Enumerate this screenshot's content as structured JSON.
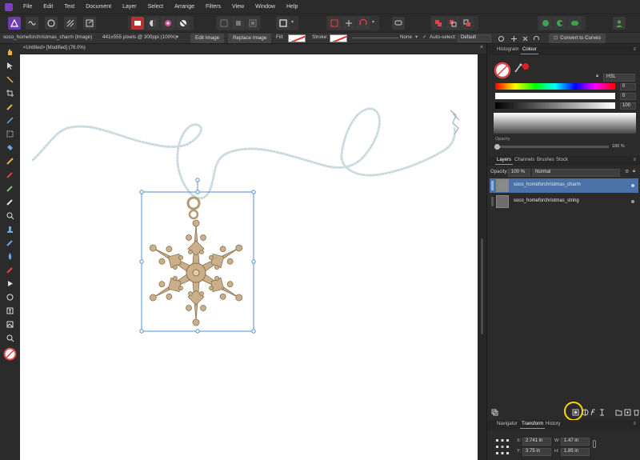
{
  "menu": {
    "items": [
      "File",
      "Edit",
      "Text",
      "Document",
      "Layer",
      "Select",
      "Arrange",
      "Filters",
      "View",
      "Window",
      "Help"
    ]
  },
  "context_toolbar": {
    "layer_name": "soco_homeforchristmas_charm (Image)",
    "image_info": "441x555 pixels @ 300ppi (100%)",
    "edit_image_label": "Edit Image",
    "replace_image_label": "Replace Image",
    "fill_label": "Fill:",
    "stroke_label": "Stroke:",
    "stroke_width_value": "None",
    "auto_select_label": "Auto-select:",
    "auto_select_value": "Default",
    "convert_to_curves_label": "Convert to Curves"
  },
  "document": {
    "tab_title": "<Untitled> [Modified] (76.0%)"
  },
  "colour_panel": {
    "tabs": [
      "Histogram",
      "Colour"
    ],
    "active_tab": "Colour",
    "model": "HSL",
    "sliders": [
      {
        "label": "H",
        "value": "0"
      },
      {
        "label": "S",
        "value": "0"
      },
      {
        "label": "L",
        "value": "100"
      }
    ],
    "opacity_label": "Opacity",
    "opacity_value": "100 %"
  },
  "layers_panel": {
    "tabs": [
      "Layers",
      "Channels",
      "Brushes",
      "Stock"
    ],
    "active_tab": "Layers",
    "opacity_label": "Opacity:",
    "opacity_value": "100 %",
    "blend_mode": "Normal",
    "layers": [
      {
        "name": "soco_homeforchristmas_charm",
        "selected": true
      },
      {
        "name": "soco_homeforchristmas_string",
        "selected": false
      }
    ]
  },
  "transform_panel": {
    "tabs": [
      "Navigator",
      "Transform",
      "History"
    ],
    "active_tab": "Transform",
    "x_label": "X:",
    "x_value": "2.741 in",
    "y_label": "Y:",
    "y_value": "3.75 in",
    "w_label": "W:",
    "w_value": "1.47 in",
    "h_label": "H:",
    "h_value": "1.85 in"
  },
  "colors": {
    "app_bg": "#2b2b2b",
    "accent": "#6a9fd8",
    "selection": "#3d6aa0",
    "highlight_circle": "#ffd400",
    "logo": "#7b3fc4"
  }
}
